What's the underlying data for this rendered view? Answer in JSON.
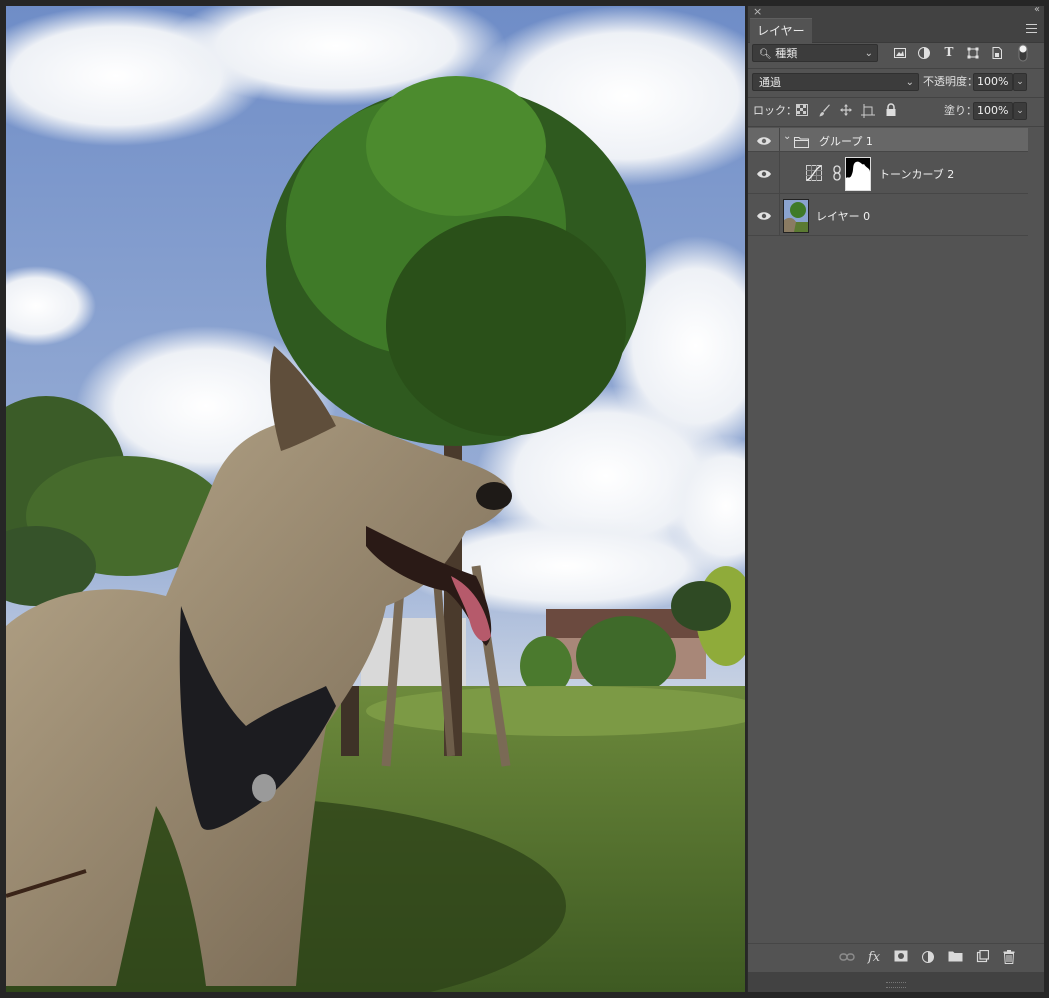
{
  "panel": {
    "tab_label": "レイヤー",
    "close_glyph": "×",
    "collapse_glyph": "‹‹",
    "filter": {
      "label": "種類",
      "icons": [
        "image-filter-icon",
        "adjustment-filter-icon",
        "type-filter-icon",
        "shape-filter-icon",
        "smart-object-filter-icon",
        "filter-toggle-icon"
      ]
    },
    "blend_mode": "通過",
    "opacity_label": "不透明度：",
    "opacity_value": "100%",
    "lock_label": "ロック：",
    "fill_label": "塗り：",
    "fill_value": "100%",
    "layers": [
      {
        "name": "グループ 1",
        "kind": "group",
        "visible": true,
        "expanded": true,
        "selected": true
      },
      {
        "name": "トーンカーブ 2",
        "kind": "adjustment-curves",
        "visible": true,
        "indent": 1
      },
      {
        "name": "レイヤー 0",
        "kind": "pixel",
        "visible": true
      }
    ],
    "bottom_buttons": [
      "link-icon",
      "fx-icon",
      "mask-icon",
      "adjustment-icon",
      "folder-icon",
      "new-layer-icon",
      "trash-icon"
    ]
  },
  "colors": {
    "panel_bg": "#535353",
    "group_selected_bg": "#676767",
    "workspace_bg": "#262626"
  }
}
